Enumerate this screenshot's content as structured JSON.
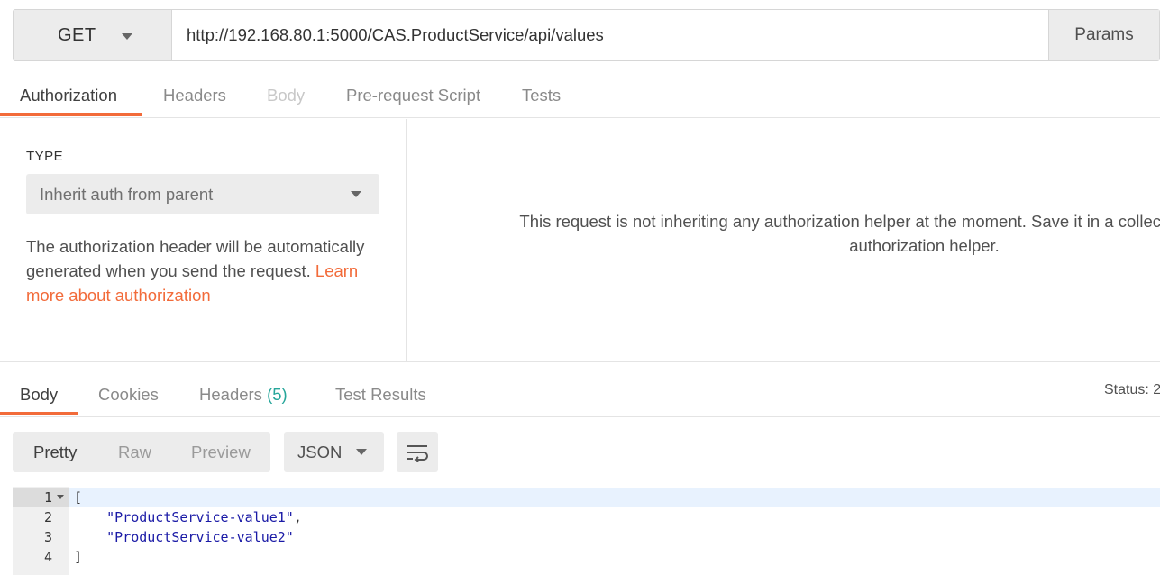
{
  "request": {
    "method": "GET",
    "url": "http://192.168.80.1:5000/CAS.ProductService/api/values",
    "params_label": "Params"
  },
  "request_tabs": [
    {
      "label": "Authorization",
      "state": "active"
    },
    {
      "label": "Headers",
      "state": "normal"
    },
    {
      "label": "Body",
      "state": "disabled"
    },
    {
      "label": "Pre-request Script",
      "state": "normal"
    },
    {
      "label": "Tests",
      "state": "normal"
    }
  ],
  "auth": {
    "type_label": "TYPE",
    "type_value": "Inherit auth from parent",
    "description": "The authorization header will be automatically generated when you send the request. ",
    "link_text": "Learn more about authorization",
    "message": "This request is not inheriting any authorization helper at the moment. Save it in a collection to use the parent's authorization helper."
  },
  "response_tabs": [
    {
      "label": "Body",
      "state": "active"
    },
    {
      "label": "Cookies",
      "state": "normal"
    },
    {
      "label": "Headers",
      "count": "(5)",
      "state": "normal"
    },
    {
      "label": "Test Results",
      "state": "normal"
    }
  ],
  "status_label": "Status: 2",
  "view_modes": [
    "Pretty",
    "Raw",
    "Preview"
  ],
  "active_view_mode": "Pretty",
  "format": "JSON",
  "code_lines": [
    {
      "n": "1",
      "text": "[",
      "foldable": true
    },
    {
      "n": "2",
      "text": "    \"ProductService-value1\","
    },
    {
      "n": "3",
      "text": "    \"ProductService-value2\""
    },
    {
      "n": "4",
      "text": "]"
    }
  ],
  "colors": {
    "accent": "#f26b3a",
    "count": "#26a69a",
    "string": "#1a1aa6"
  }
}
